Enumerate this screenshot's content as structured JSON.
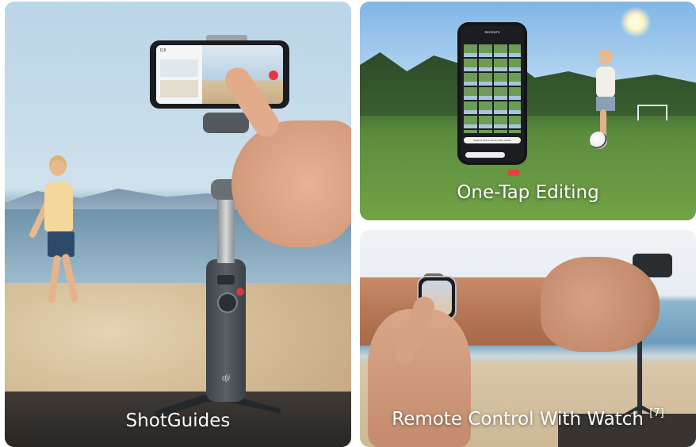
{
  "tiles": [
    {
      "caption": "ShotGuides"
    },
    {
      "caption": "One-Tap Editing"
    },
    {
      "caption": "Remote Control With Watch",
      "footnote": "[7]"
    }
  ],
  "phone_screen": {
    "brand": "DJI",
    "tab_recents": "RECENTS",
    "banner": "Select a tool to use its cover results"
  },
  "product_logo": "dji"
}
